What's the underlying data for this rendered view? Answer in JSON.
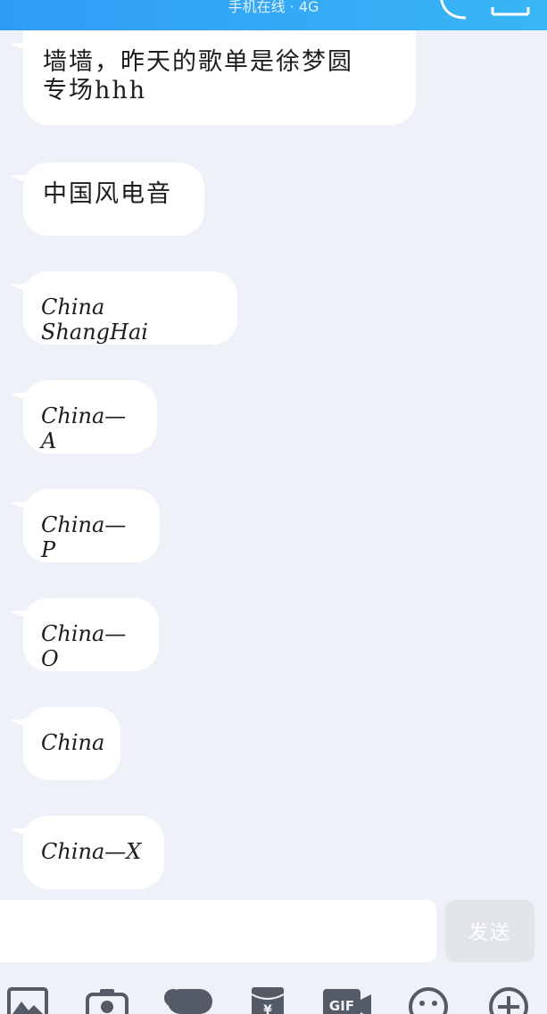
{
  "header": {
    "status_text": "手机在线 · 4G",
    "icons": [
      "call-icon",
      "menu-icon"
    ]
  },
  "messages": [
    {
      "text": "墙墙，昨天的歌单是徐梦圆\n专场hhh"
    },
    {
      "text": "中国风电音"
    },
    {
      "text": "China  ShangHai"
    },
    {
      "text": "China—A"
    },
    {
      "text": "China—P"
    },
    {
      "text": "China—O"
    },
    {
      "text": "China"
    },
    {
      "text": "China—X"
    }
  ],
  "composer": {
    "input_value": "",
    "send_label": "发送"
  },
  "toolbar": {
    "icons": [
      "image-icon",
      "camera-icon",
      "voice-icon",
      "red-packet-icon",
      "gif-icon",
      "emoji-icon",
      "plus-icon"
    ],
    "gif_label": "GIF",
    "yen_label": "¥"
  },
  "colors": {
    "header": "#2f9bf6",
    "background": "#eef1f7",
    "bubble": "#ffffff",
    "send_disabled": "#e1e4e9",
    "icon": "#545b66"
  }
}
